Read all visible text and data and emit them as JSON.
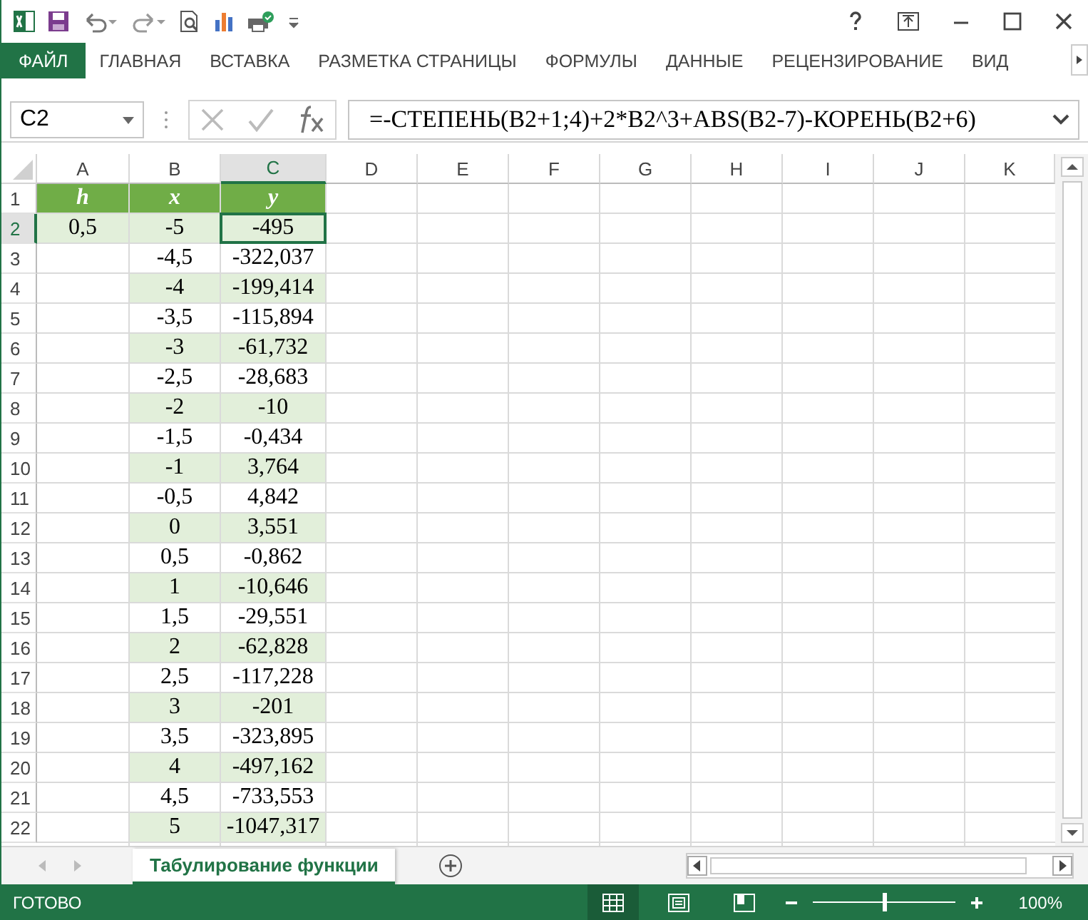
{
  "ribbon_tabs": [
    {
      "label": "ФАЙЛ",
      "selected": true
    },
    {
      "label": "ГЛАВНАЯ",
      "selected": false
    },
    {
      "label": "ВСТАВКА",
      "selected": false
    },
    {
      "label": "РАЗМЕТКА СТРАНИЦЫ",
      "selected": false
    },
    {
      "label": "ФОРМУЛЫ",
      "selected": false
    },
    {
      "label": "ДАННЫЕ",
      "selected": false
    },
    {
      "label": "РЕЦЕНЗИРОВАНИЕ",
      "selected": false
    },
    {
      "label": "ВИД",
      "selected": false
    }
  ],
  "formula_bar": {
    "name_box": "C2",
    "formula": "=-СТЕПЕНЬ(B2+1;4)+2*B2^3+ABS(B2-7)-КОРЕНЬ(B2+6)"
  },
  "grid": {
    "columns": [
      {
        "label": "A",
        "selected": false
      },
      {
        "label": "B",
        "selected": false
      },
      {
        "label": "C",
        "selected": true
      },
      {
        "label": "D",
        "selected": false
      },
      {
        "label": "E",
        "selected": false
      },
      {
        "label": "F",
        "selected": false
      },
      {
        "label": "G",
        "selected": false
      },
      {
        "label": "H",
        "selected": false
      },
      {
        "label": "I",
        "selected": false
      },
      {
        "label": "J",
        "selected": false
      },
      {
        "label": "K",
        "selected": false
      }
    ],
    "rows": [
      {
        "label": "1",
        "selected": false,
        "cells": [
          {
            "kind": "header",
            "text": "h",
            "selected": false
          },
          {
            "kind": "header",
            "text": "x",
            "selected": false
          },
          {
            "kind": "header",
            "text": "y",
            "selected": false
          }
        ]
      },
      {
        "label": "2",
        "selected": true,
        "cells": [
          {
            "kind": "data",
            "text": "0,5",
            "shaded": true,
            "selected": false
          },
          {
            "kind": "data",
            "text": "-5",
            "shaded": true,
            "selected": false
          },
          {
            "kind": "data",
            "text": "-495",
            "shaded": true,
            "selected": true
          }
        ]
      },
      {
        "label": "3",
        "selected": false,
        "cells": [
          {
            "kind": "empty",
            "selected": false
          },
          {
            "kind": "data",
            "text": "-4,5",
            "shaded": false,
            "selected": false
          },
          {
            "kind": "data",
            "text": "-322,037",
            "shaded": false,
            "selected": false
          }
        ]
      },
      {
        "label": "4",
        "selected": false,
        "cells": [
          {
            "kind": "empty",
            "selected": false
          },
          {
            "kind": "data",
            "text": "-4",
            "shaded": true,
            "selected": false
          },
          {
            "kind": "data",
            "text": "-199,414",
            "shaded": true,
            "selected": false
          }
        ]
      },
      {
        "label": "5",
        "selected": false,
        "cells": [
          {
            "kind": "empty",
            "selected": false
          },
          {
            "kind": "data",
            "text": "-3,5",
            "shaded": false,
            "selected": false
          },
          {
            "kind": "data",
            "text": "-115,894",
            "shaded": false,
            "selected": false
          }
        ]
      },
      {
        "label": "6",
        "selected": false,
        "cells": [
          {
            "kind": "empty",
            "selected": false
          },
          {
            "kind": "data",
            "text": "-3",
            "shaded": true,
            "selected": false
          },
          {
            "kind": "data",
            "text": "-61,732",
            "shaded": true,
            "selected": false
          }
        ]
      },
      {
        "label": "7",
        "selected": false,
        "cells": [
          {
            "kind": "empty",
            "selected": false
          },
          {
            "kind": "data",
            "text": "-2,5",
            "shaded": false,
            "selected": false
          },
          {
            "kind": "data",
            "text": "-28,683",
            "shaded": false,
            "selected": false
          }
        ]
      },
      {
        "label": "8",
        "selected": false,
        "cells": [
          {
            "kind": "empty",
            "selected": false
          },
          {
            "kind": "data",
            "text": "-2",
            "shaded": true,
            "selected": false
          },
          {
            "kind": "data",
            "text": "-10",
            "shaded": true,
            "selected": false
          }
        ]
      },
      {
        "label": "9",
        "selected": false,
        "cells": [
          {
            "kind": "empty",
            "selected": false
          },
          {
            "kind": "data",
            "text": "-1,5",
            "shaded": false,
            "selected": false
          },
          {
            "kind": "data",
            "text": "-0,434",
            "shaded": false,
            "selected": false
          }
        ]
      },
      {
        "label": "10",
        "selected": false,
        "cells": [
          {
            "kind": "empty",
            "selected": false
          },
          {
            "kind": "data",
            "text": "-1",
            "shaded": true,
            "selected": false
          },
          {
            "kind": "data",
            "text": "3,764",
            "shaded": true,
            "selected": false
          }
        ]
      },
      {
        "label": "11",
        "selected": false,
        "cells": [
          {
            "kind": "empty",
            "selected": false
          },
          {
            "kind": "data",
            "text": "-0,5",
            "shaded": false,
            "selected": false
          },
          {
            "kind": "data",
            "text": "4,842",
            "shaded": false,
            "selected": false
          }
        ]
      },
      {
        "label": "12",
        "selected": false,
        "cells": [
          {
            "kind": "empty",
            "selected": false
          },
          {
            "kind": "data",
            "text": "0",
            "shaded": true,
            "selected": false
          },
          {
            "kind": "data",
            "text": "3,551",
            "shaded": true,
            "selected": false
          }
        ]
      },
      {
        "label": "13",
        "selected": false,
        "cells": [
          {
            "kind": "empty",
            "selected": false
          },
          {
            "kind": "data",
            "text": "0,5",
            "shaded": false,
            "selected": false
          },
          {
            "kind": "data",
            "text": "-0,862",
            "shaded": false,
            "selected": false
          }
        ]
      },
      {
        "label": "14",
        "selected": false,
        "cells": [
          {
            "kind": "empty",
            "selected": false
          },
          {
            "kind": "data",
            "text": "1",
            "shaded": true,
            "selected": false
          },
          {
            "kind": "data",
            "text": "-10,646",
            "shaded": true,
            "selected": false
          }
        ]
      },
      {
        "label": "15",
        "selected": false,
        "cells": [
          {
            "kind": "empty",
            "selected": false
          },
          {
            "kind": "data",
            "text": "1,5",
            "shaded": false,
            "selected": false
          },
          {
            "kind": "data",
            "text": "-29,551",
            "shaded": false,
            "selected": false
          }
        ]
      },
      {
        "label": "16",
        "selected": false,
        "cells": [
          {
            "kind": "empty",
            "selected": false
          },
          {
            "kind": "data",
            "text": "2",
            "shaded": true,
            "selected": false
          },
          {
            "kind": "data",
            "text": "-62,828",
            "shaded": true,
            "selected": false
          }
        ]
      },
      {
        "label": "17",
        "selected": false,
        "cells": [
          {
            "kind": "empty",
            "selected": false
          },
          {
            "kind": "data",
            "text": "2,5",
            "shaded": false,
            "selected": false
          },
          {
            "kind": "data",
            "text": "-117,228",
            "shaded": false,
            "selected": false
          }
        ]
      },
      {
        "label": "18",
        "selected": false,
        "cells": [
          {
            "kind": "empty",
            "selected": false
          },
          {
            "kind": "data",
            "text": "3",
            "shaded": true,
            "selected": false
          },
          {
            "kind": "data",
            "text": "-201",
            "shaded": true,
            "selected": false
          }
        ]
      },
      {
        "label": "19",
        "selected": false,
        "cells": [
          {
            "kind": "empty",
            "selected": false
          },
          {
            "kind": "data",
            "text": "3,5",
            "shaded": false,
            "selected": false
          },
          {
            "kind": "data",
            "text": "-323,895",
            "shaded": false,
            "selected": false
          }
        ]
      },
      {
        "label": "20",
        "selected": false,
        "cells": [
          {
            "kind": "empty",
            "selected": false
          },
          {
            "kind": "data",
            "text": "4",
            "shaded": true,
            "selected": false
          },
          {
            "kind": "data",
            "text": "-497,162",
            "shaded": true,
            "selected": false
          }
        ]
      },
      {
        "label": "21",
        "selected": false,
        "cells": [
          {
            "kind": "empty",
            "selected": false
          },
          {
            "kind": "data",
            "text": "4,5",
            "shaded": false,
            "selected": false
          },
          {
            "kind": "data",
            "text": "-733,553",
            "shaded": false,
            "selected": false
          }
        ]
      },
      {
        "label": "22",
        "selected": false,
        "cells": [
          {
            "kind": "empty",
            "selected": false
          },
          {
            "kind": "data",
            "text": "5",
            "shaded": true,
            "selected": false
          },
          {
            "kind": "data",
            "text": "-1047,317",
            "shaded": true,
            "selected": false
          }
        ]
      }
    ]
  },
  "sheet_tabs": [
    {
      "label": "Табулирование функции",
      "selected": true
    }
  ],
  "status_bar": {
    "status": "ГОТОВО",
    "views": [
      {
        "kind": "normal",
        "selected": true
      },
      {
        "kind": "page-layout",
        "selected": false
      },
      {
        "kind": "page-break",
        "selected": false
      }
    ],
    "zoom": {
      "level": 0.5,
      "reading": "100%"
    }
  }
}
